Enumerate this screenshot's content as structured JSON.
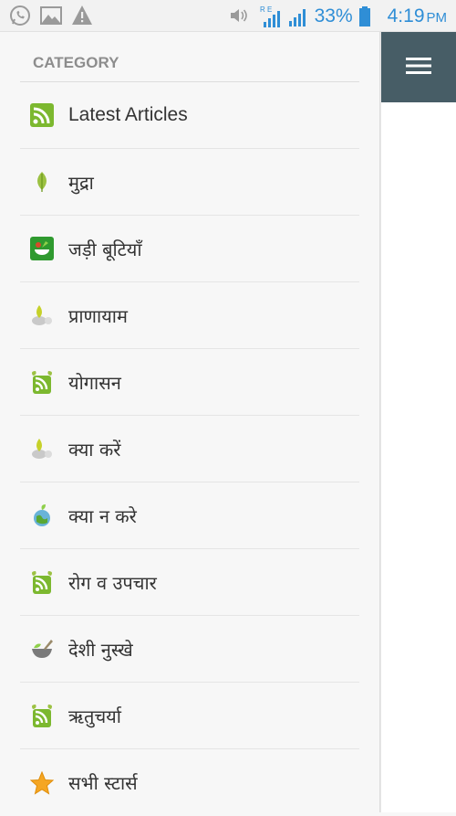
{
  "status_bar": {
    "battery_percent": "33%",
    "time": "4:19",
    "ampm": "PM",
    "network_badge": "R E",
    "icons": [
      "whatsapp-icon",
      "gallery-icon",
      "warning-icon",
      "volume-icon",
      "signal-icon",
      "signal-icon",
      "battery-icon"
    ],
    "accent_color": "#2f8ed6"
  },
  "drawer": {
    "header": "CATEGORY",
    "items": [
      {
        "label": "Latest Articles",
        "icon": "rss-icon"
      },
      {
        "label": "मुद्रा",
        "icon": "leaf-icon"
      },
      {
        "label": "जड़ी बूटियाँ",
        "icon": "herbs-icon"
      },
      {
        "label": "प्राणायाम",
        "icon": "herbal-medicine-icon"
      },
      {
        "label": "योगासन",
        "icon": "rss-leaf-icon"
      },
      {
        "label": "क्या करें",
        "icon": "herbal-medicine-icon"
      },
      {
        "label": "क्या न करे",
        "icon": "eco-globe-icon"
      },
      {
        "label": "रोग व उपचार",
        "icon": "rss-leaf-icon"
      },
      {
        "label": "देशी नुस्खे",
        "icon": "mortar-icon"
      },
      {
        "label": "ऋतुचर्या",
        "icon": "rss-leaf-icon"
      },
      {
        "label": "सभी स्टार्स",
        "icon": "star-icon"
      }
    ]
  },
  "toolbar": {
    "menu_button_color": "#475d66",
    "menu_icon": "hamburger-menu-icon"
  }
}
